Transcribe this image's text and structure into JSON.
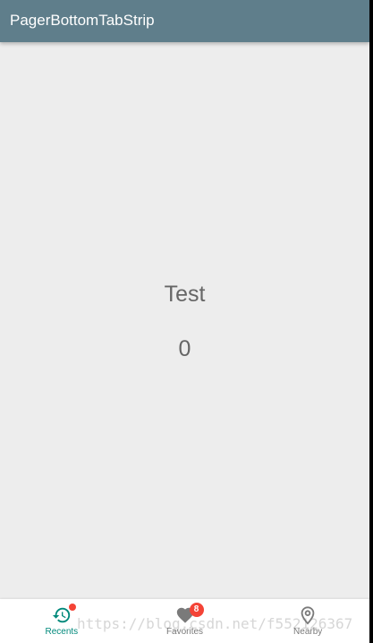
{
  "app_bar": {
    "title": "PagerBottomTabStrip",
    "color": "#5f7e8b"
  },
  "content": {
    "title": "Test",
    "count": "0"
  },
  "bottom_nav": {
    "active_color": "#00897b",
    "inactive_color": "#7a7a7a",
    "badge_color": "#f44336",
    "tabs": [
      {
        "label": "Recents",
        "icon": "history-icon",
        "active": true,
        "badge": "dot"
      },
      {
        "label": "Favorites",
        "icon": "heart-icon",
        "active": false,
        "badge": "8"
      },
      {
        "label": "Nearby",
        "icon": "location-pin-icon",
        "active": false,
        "badge": ""
      }
    ]
  },
  "watermark": {
    "text": "https://blog.csdn.net/f552126367"
  }
}
